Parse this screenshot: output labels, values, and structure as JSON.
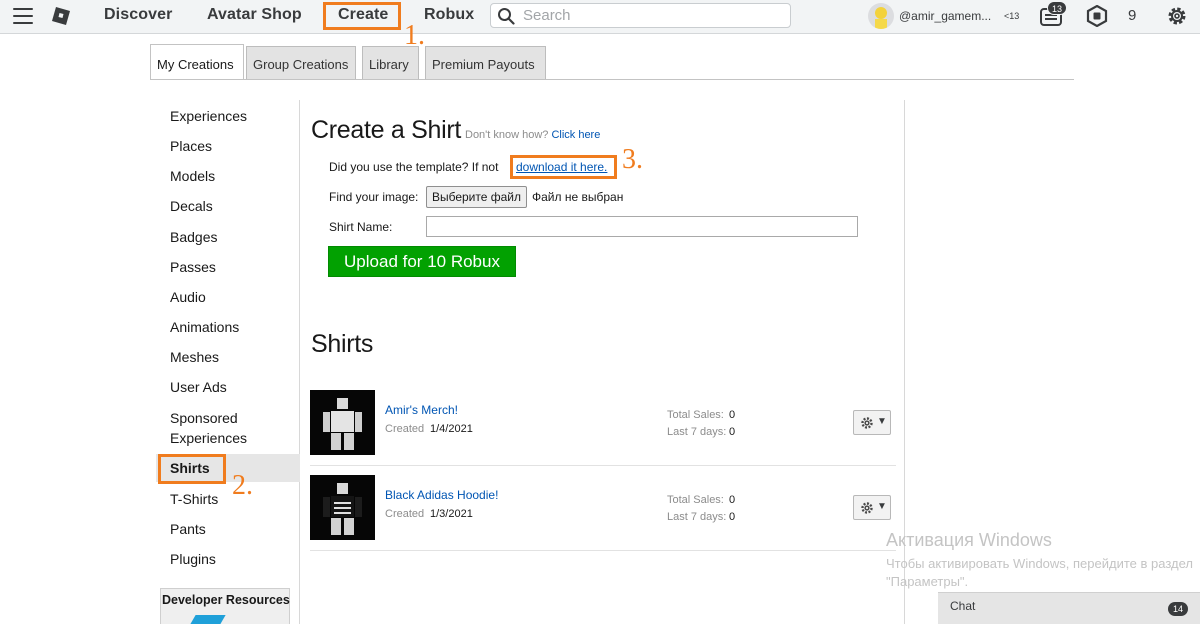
{
  "topnav": {
    "discover": "Discover",
    "avatar_shop": "Avatar Shop",
    "create": "Create",
    "robux": "Robux",
    "search_placeholder": "Search",
    "username": "@amir_gamem...",
    "age": "<13",
    "messages_count": "13",
    "robux_balance": "9"
  },
  "tabs": [
    "My Creations",
    "Group Creations",
    "Library",
    "Premium Payouts"
  ],
  "sidebar": {
    "items": [
      "Experiences",
      "Places",
      "Models",
      "Decals",
      "Badges",
      "Passes",
      "Audio",
      "Animations",
      "Meshes",
      "User Ads",
      "Sponsored Experiences",
      "Shirts",
      "T-Shirts",
      "Pants",
      "Plugins"
    ],
    "selected": "Shirts",
    "developer_resources": "Developer Resources"
  },
  "create": {
    "title": "Create a Shirt",
    "help_text": "Don't know how?",
    "help_link": "Click here",
    "template_text": "Did you use the template? If not",
    "template_link": "download it here.",
    "find_image_label": "Find your image:",
    "file_button": "Выберите файл",
    "file_none": "Файл не выбран",
    "name_label": "Shirt Name:",
    "name_value": "",
    "upload_button": "Upload for 10 Robux"
  },
  "shirts": {
    "title": "Shirts",
    "created_label": "Created",
    "total_sales_label": "Total Sales:",
    "last7_label": "Last 7 days:",
    "items": [
      {
        "name": "Amir's Merch!",
        "created": "1/4/2021",
        "total_sales": "0",
        "last7": "0"
      },
      {
        "name": "Black Adidas Hoodie!",
        "created": "1/3/2021",
        "total_sales": "0",
        "last7": "0"
      }
    ]
  },
  "annotations": [
    "1.",
    "2.",
    "3."
  ],
  "watermark": {
    "title": "Активация Windows",
    "subtitle": "Чтобы активировать Windows, перейдите в раздел \"Параметры\"."
  },
  "chat": {
    "label": "Chat",
    "count": "14"
  },
  "colors": {
    "annotation": "#f07c1e",
    "link": "#0055b3",
    "upload_green": "#02a101"
  }
}
